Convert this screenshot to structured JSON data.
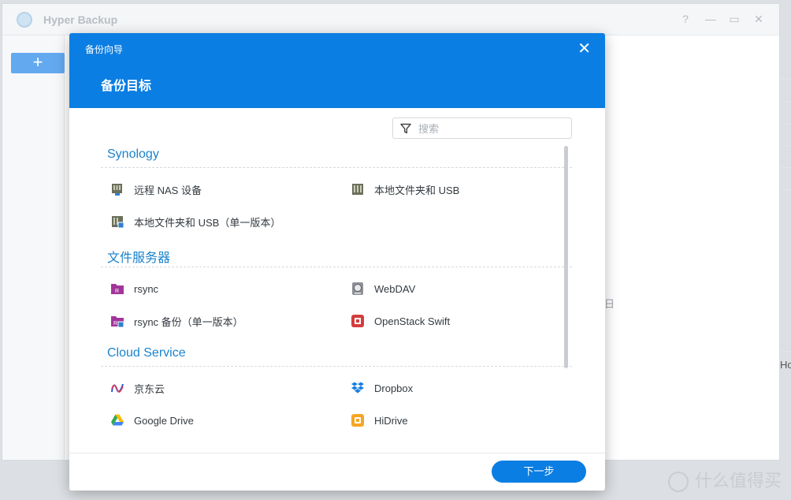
{
  "app": {
    "title": "Hyper Backup",
    "add_label": "+",
    "help_label": "?",
    "minimize_label": "—",
    "maximize_label": "▭",
    "close_label": "✕",
    "fragment_b": "日",
    "fragment_ho": "Ho"
  },
  "dialog": {
    "wizard_title": "备份向导",
    "step_title": "备份目标",
    "close_label": "✕",
    "search": {
      "placeholder": "搜索"
    },
    "sections": [
      {
        "title": "Synology"
      },
      {
        "title": "文件服务器"
      },
      {
        "title": "Cloud Service"
      }
    ],
    "items": [
      {
        "label": "远程 NAS 设备",
        "icon": "remote-nas-icon"
      },
      {
        "label": "本地文件夹和 USB",
        "icon": "local-folder-usb-icon"
      },
      {
        "label": "本地文件夹和 USB（单一版本）",
        "icon": "local-folder-usb-single-icon"
      },
      {
        "label": "rsync",
        "icon": "rsync-icon"
      },
      {
        "label": "WebDAV",
        "icon": "webdav-icon"
      },
      {
        "label": "rsync 备份（单一版本）",
        "icon": "rsync-single-icon"
      },
      {
        "label": "OpenStack Swift",
        "icon": "openstack-swift-icon"
      },
      {
        "label": "京东云",
        "icon": "jdcloud-icon"
      },
      {
        "label": "Dropbox",
        "icon": "dropbox-icon"
      },
      {
        "label": "Google Drive",
        "icon": "google-drive-icon"
      },
      {
        "label": "HiDrive",
        "icon": "hidrive-icon"
      }
    ],
    "next_label": "下一步"
  },
  "colors": {
    "header_blue": "#0b7ee3",
    "section_blue": "#1a83cc",
    "rsync_purple": "#a2359a",
    "openstack_red": "#d63c3c",
    "dropbox_blue": "#1a7fe0",
    "hidrive_orange": "#f5a623"
  },
  "watermark": {
    "text": "什么值得买"
  }
}
